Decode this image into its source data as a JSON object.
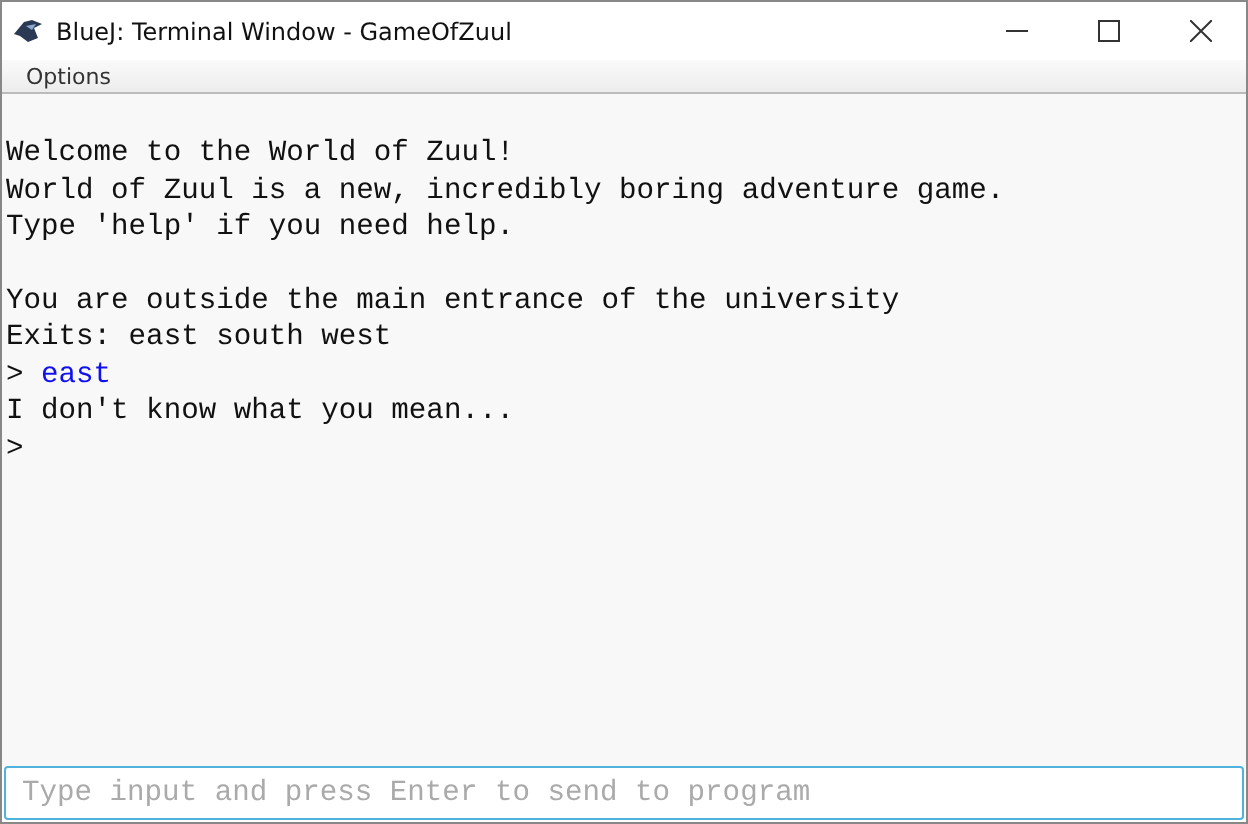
{
  "window": {
    "title": "BlueJ: Terminal Window - GameOfZuul"
  },
  "menu": [
    "Options"
  ],
  "terminal": {
    "lines": [
      {
        "kind": "blank"
      },
      {
        "kind": "output",
        "text": "Welcome to the World of Zuul!"
      },
      {
        "kind": "output",
        "text": "World of Zuul is a new, incredibly boring adventure game."
      },
      {
        "kind": "output",
        "text": "Type 'help' if you need help."
      },
      {
        "kind": "blank"
      },
      {
        "kind": "output",
        "text": "You are outside the main entrance of the university"
      },
      {
        "kind": "output",
        "text": "Exits: east south west"
      },
      {
        "kind": "input",
        "prompt": ">",
        "text": "east"
      },
      {
        "kind": "output",
        "text": "I don't know what you mean..."
      },
      {
        "kind": "prompt",
        "prompt": ">"
      }
    ]
  },
  "input": {
    "placeholder": "Type input and press Enter to send to program"
  }
}
